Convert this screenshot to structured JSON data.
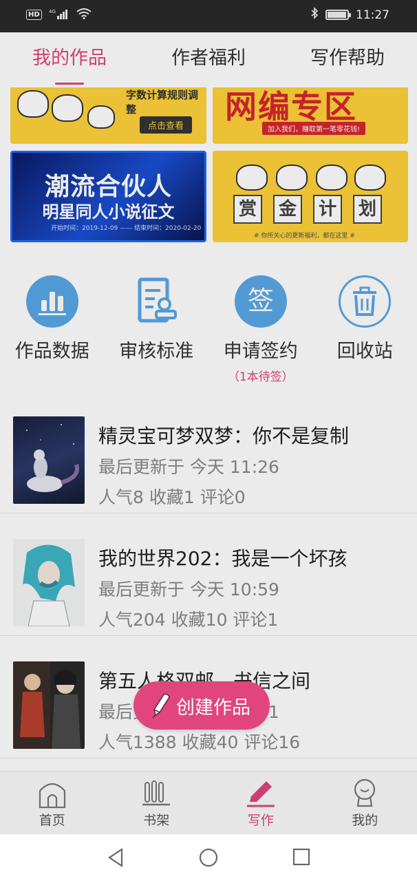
{
  "status_bar": {
    "network_badge": "HD",
    "signal_label": "4G",
    "time": "11:27",
    "battery_level": 0.9
  },
  "tabs": [
    {
      "label": "我的作品",
      "active": true
    },
    {
      "label": "作者福利",
      "active": false
    },
    {
      "label": "写作帮助",
      "active": false
    }
  ],
  "banners": {
    "b1": {
      "text": "字数计算规则调整",
      "button": "点击查看"
    },
    "b2": {
      "text": "网编专区",
      "sub": "加入我们，赚取第一笔零花钱!"
    },
    "b3": {
      "title": "潮流合伙人",
      "subtitle": "明星同人小说征文",
      "dates": "开始时间：2019-12-09 —— 结束时间：2020-02-20"
    },
    "b4": {
      "chars": [
        "赏",
        "金",
        "计",
        "划"
      ],
      "note": "# 你所关心的更新福利，都在这里 #"
    }
  },
  "quick_actions": [
    {
      "label": "作品数据",
      "icon": "bar-chart-icon"
    },
    {
      "label": "审核标准",
      "icon": "document-review-icon"
    },
    {
      "label": "申请签约",
      "icon": "sign-icon",
      "glyph": "签",
      "sub": "（1本待签）"
    },
    {
      "label": "回收站",
      "icon": "trash-icon"
    }
  ],
  "works": [
    {
      "title": "精灵宝可梦双梦：你不是复制",
      "updated": "最后更新于 今天 11:26",
      "stats": "人气8 收藏1 评论0"
    },
    {
      "title": "我的世界202：我是一个坏孩",
      "updated": "最后更新于 今天 10:59",
      "stats": "人气204 收藏10 评论1"
    },
    {
      "title": "第五人格双邮，书信之间",
      "updated": "最后更新于 今天 10:41",
      "stats": "人气1388 收藏40 评论16"
    }
  ],
  "fab": {
    "label": "创建作品"
  },
  "bottom_nav": [
    {
      "label": "首页",
      "icon": "home-icon",
      "active": false
    },
    {
      "label": "书架",
      "icon": "bookshelf-icon",
      "active": false
    },
    {
      "label": "写作",
      "icon": "write-icon",
      "active": true
    },
    {
      "label": "我的",
      "icon": "profile-icon",
      "active": false
    }
  ],
  "colors": {
    "accent": "#e0457b",
    "icon_blue": "#5aa8e6",
    "status_bar": "#262626"
  }
}
